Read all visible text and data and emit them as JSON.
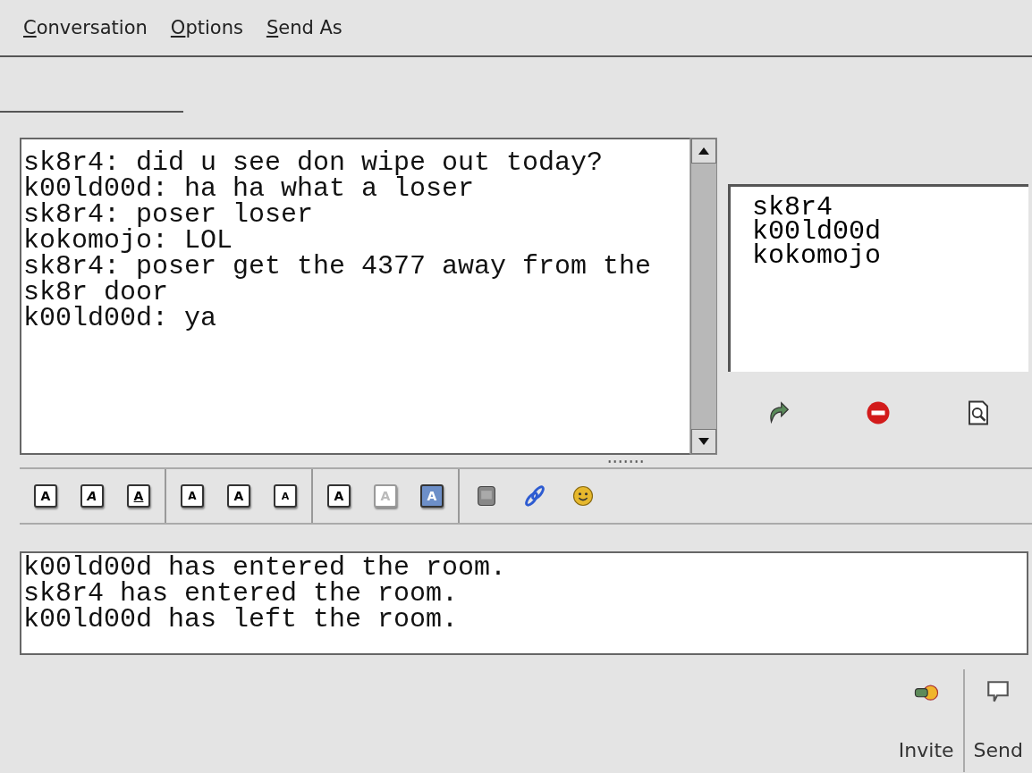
{
  "menu": [
    {
      "label": "Conversation"
    },
    {
      "label": "Options"
    },
    {
      "label": "Send As"
    }
  ],
  "chat": {
    "lines": [
      "sk8r4: did u see don wipe out today?",
      "k00ld00d: ha ha what a loser",
      "sk8r4: poser loser",
      "kokomojo: LOL",
      "sk8r4: poser get the 4377 away from the sk8r door",
      "k00ld00d: ya"
    ]
  },
  "buddies": [
    "sk8r4",
    "k00ld00d",
    "kokomojo"
  ],
  "buddy_actions": [
    {
      "kind": "redirect"
    },
    {
      "kind": "block"
    },
    {
      "kind": "info"
    }
  ],
  "format_toolbar": [
    [
      {
        "kind": "bold",
        "label": "A"
      },
      {
        "kind": "italic",
        "label": "A"
      },
      {
        "kind": "underline",
        "label": "A"
      }
    ],
    [
      {
        "kind": "grow",
        "label": "A"
      },
      {
        "kind": "normal",
        "label": "A"
      },
      {
        "kind": "shrink",
        "label": "A"
      }
    ],
    [
      {
        "kind": "face",
        "label": "A"
      },
      {
        "kind": "fg",
        "label": "A"
      },
      {
        "kind": "bg",
        "label": "A"
      }
    ],
    [
      {
        "kind": "image"
      },
      {
        "kind": "link"
      },
      {
        "kind": "smiley"
      }
    ]
  ],
  "input": {
    "value": "k00ld00d has entered the room.\nsk8r4 has entered the room.\nk00ld00d has left the room."
  },
  "buttons": [
    {
      "kind": "invite",
      "label": "Invite"
    },
    {
      "kind": "send",
      "label": "Send"
    }
  ]
}
